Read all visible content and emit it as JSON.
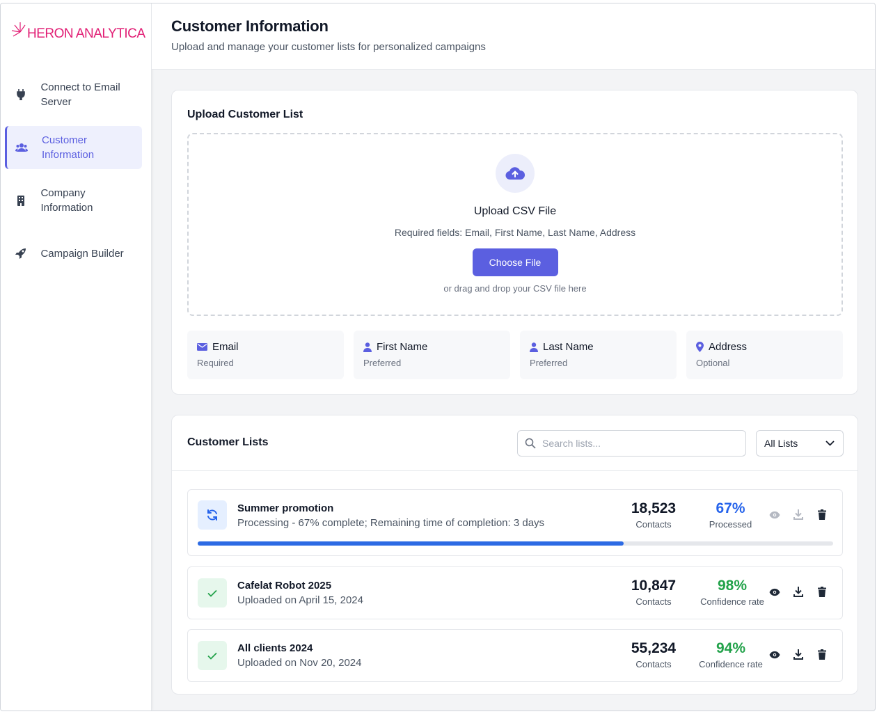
{
  "brand": {
    "name": "HERON ANALYTICA",
    "color": "#e11d74"
  },
  "sidebar": {
    "items": [
      {
        "label": "Connect to Email Server",
        "icon": "plug-icon",
        "active": false
      },
      {
        "label": "Customer Information",
        "icon": "users-icon",
        "active": true
      },
      {
        "label": "Company Information",
        "icon": "building-icon",
        "active": false
      },
      {
        "label": "Campaign Builder",
        "icon": "rocket-icon",
        "active": false
      }
    ]
  },
  "header": {
    "title": "Customer Information",
    "subtitle": "Upload and manage your customer lists for personalized campaigns"
  },
  "upload": {
    "title": "Upload Customer List",
    "dropzone_title": "Upload CSV File",
    "required_text": "Required fields: Email, First Name, Last Name, Address",
    "button_label": "Choose File",
    "hint": "or drag and drop your CSV file here",
    "fields": [
      {
        "name": "Email",
        "status": "Required",
        "icon": "envelope-icon"
      },
      {
        "name": "First Name",
        "status": "Preferred",
        "icon": "user-icon"
      },
      {
        "name": "Last Name",
        "status": "Preferred",
        "icon": "user-icon"
      },
      {
        "name": "Address",
        "status": "Optional",
        "icon": "map-pin-icon"
      }
    ]
  },
  "lists": {
    "title": "Customer Lists",
    "search_placeholder": "Search lists...",
    "filter_value": "All Lists",
    "rows": [
      {
        "name": "Summer promotion",
        "sub": "Processing - 67% complete; Remaining time of completion: 3 days",
        "contacts": "18,523",
        "contacts_label": "Contacts",
        "pct": "67%",
        "pct_label": "Processed",
        "progress": 0.67
      },
      {
        "name": "Cafelat Robot 2025",
        "sub": "Uploaded on April 15, 2024",
        "contacts": "10,847",
        "contacts_label": "Contacts",
        "pct": "98%",
        "pct_label": "Confidence rate"
      },
      {
        "name": "All clients 2024",
        "sub": "Uploaded on Nov 20, 2024",
        "contacts": "55,234",
        "contacts_label": "Contacts",
        "pct": "94%",
        "pct_label": "Confidence rate"
      }
    ]
  },
  "colors": {
    "accent": "#5b5fe0",
    "progress": "#2d6be4",
    "success": "#22a24a",
    "processing": "#2563eb"
  }
}
